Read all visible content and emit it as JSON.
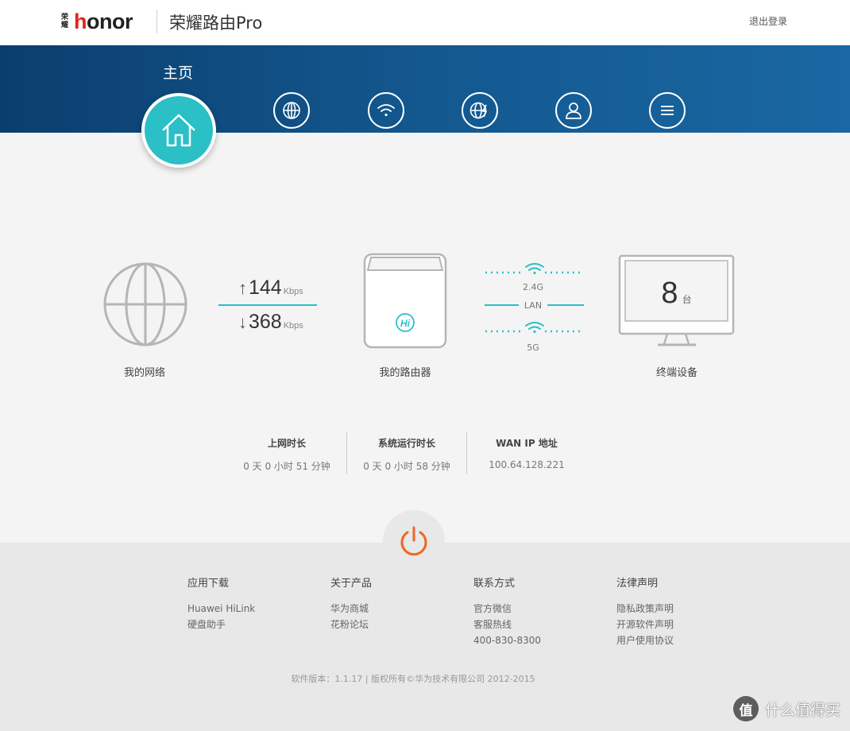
{
  "header": {
    "logo_cn": "荣耀",
    "logo_text_a": "h",
    "logo_text_b": "onor",
    "product_name": "荣耀路由Pro",
    "logout": "退出登录"
  },
  "nav": {
    "home_label": "主页",
    "items": [
      "home-icon",
      "globe-icon",
      "wifi-icon",
      "globe-lightning-icon",
      "user-icon",
      "menu-icon"
    ]
  },
  "topology": {
    "network_label": "我的网络",
    "upload": {
      "value": "144",
      "unit": "Kbps"
    },
    "download": {
      "value": "368",
      "unit": "Kbps"
    },
    "router_label": "我的路由器",
    "band_24": "2.4G",
    "lan": "LAN",
    "band_5": "5G",
    "devices_count": "8",
    "devices_unit": "台",
    "devices_label": "终端设备"
  },
  "stats": [
    {
      "title": "上网时长",
      "value": "0 天 0 小时 51 分钟"
    },
    {
      "title": "系统运行时长",
      "value": "0 天 0 小时 58 分钟"
    },
    {
      "title": "WAN IP 地址",
      "value": "100.64.128.221"
    }
  ],
  "footer": {
    "columns": [
      {
        "title": "应用下载",
        "links": [
          "Huawei HiLink",
          "硬盘助手"
        ]
      },
      {
        "title": "关于产品",
        "links": [
          "华为商城",
          "花粉论坛"
        ]
      },
      {
        "title": "联系方式",
        "links": [
          "官方微信",
          "客服热线",
          "400-830-8300"
        ]
      },
      {
        "title": "法律声明",
        "links": [
          "隐私政策声明",
          "开源软件声明",
          "用户使用协议"
        ]
      }
    ],
    "copyright": "软件版本：1.1.17  |  版权所有©华为技术有限公司 2012-2015"
  },
  "watermark": {
    "mark": "值",
    "text": "什么值得买"
  },
  "colors": {
    "accent": "#2bbfc6",
    "nav_bg": "#13588f",
    "power": "#f26522",
    "brand_red": "#e2231a"
  }
}
